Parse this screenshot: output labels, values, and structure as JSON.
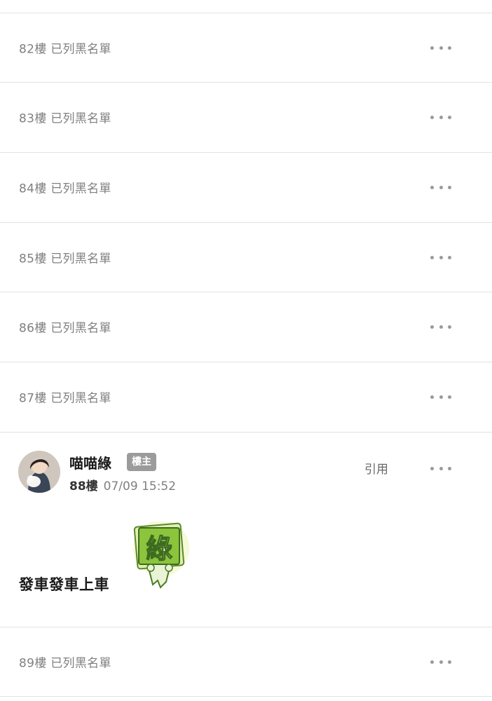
{
  "rows_top": [
    {
      "label": "82樓 已列黑名單"
    },
    {
      "label": "83樓 已列黑名單"
    },
    {
      "label": "84樓 已列黑名單"
    },
    {
      "label": "85樓 已列黑名單"
    },
    {
      "label": "86樓 已列黑名單"
    },
    {
      "label": "87樓 已列黑名單"
    }
  ],
  "post": {
    "author": "喵喵綠",
    "badge": "樓主",
    "floor": "88樓",
    "time": "07/09 15:52",
    "quote_label": "引用",
    "content": "發車發車上車",
    "sticker_char": "綠",
    "avatar_icon": "user-avatar",
    "more_icon": "more-dots-icon"
  },
  "row_bottom": {
    "label": "89樓 已列黑名單"
  },
  "colors": {
    "divider": "#e2e2e2",
    "muted_text": "#808080",
    "badge_bg": "#9b9b9b",
    "sticker_green": "#8cc43c"
  }
}
